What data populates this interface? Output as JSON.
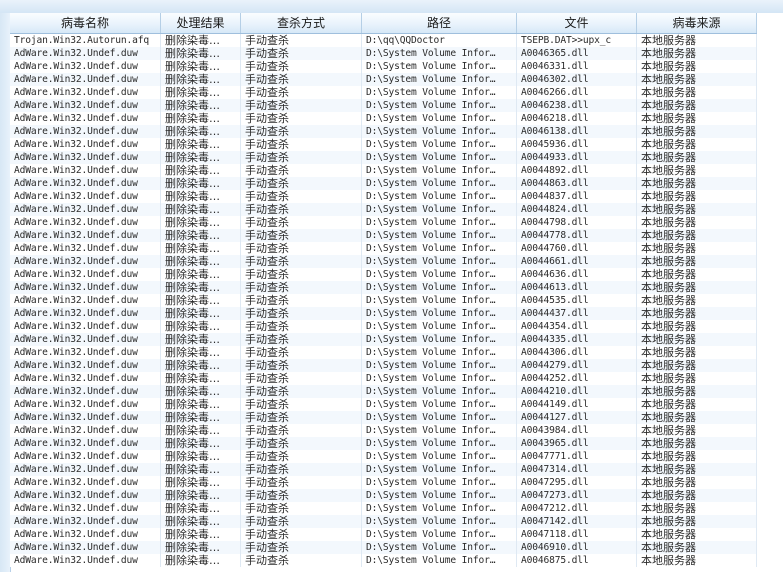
{
  "columns": [
    "病毒名称",
    "处理结果",
    "查杀方式",
    "路径",
    "文件",
    "病毒来源"
  ],
  "rows": [
    [
      "Trojan.Win32.Autorun.afq",
      "删除染毒…",
      "手动查杀",
      "D:\\qq\\QQDoctor",
      "TSEPB.DAT>>upx_c",
      "本地服务器"
    ],
    [
      "AdWare.Win32.Undef.duw",
      "删除染毒…",
      "手动查杀",
      "D:\\System Volume Infor…",
      "A0046365.dll",
      "本地服务器"
    ],
    [
      "AdWare.Win32.Undef.duw",
      "删除染毒…",
      "手动查杀",
      "D:\\System Volume Infor…",
      "A0046331.dll",
      "本地服务器"
    ],
    [
      "AdWare.Win32.Undef.duw",
      "删除染毒…",
      "手动查杀",
      "D:\\System Volume Infor…",
      "A0046302.dll",
      "本地服务器"
    ],
    [
      "AdWare.Win32.Undef.duw",
      "删除染毒…",
      "手动查杀",
      "D:\\System Volume Infor…",
      "A0046266.dll",
      "本地服务器"
    ],
    [
      "AdWare.Win32.Undef.duw",
      "删除染毒…",
      "手动查杀",
      "D:\\System Volume Infor…",
      "A0046238.dll",
      "本地服务器"
    ],
    [
      "AdWare.Win32.Undef.duw",
      "删除染毒…",
      "手动查杀",
      "D:\\System Volume Infor…",
      "A0046218.dll",
      "本地服务器"
    ],
    [
      "AdWare.Win32.Undef.duw",
      "删除染毒…",
      "手动查杀",
      "D:\\System Volume Infor…",
      "A0046138.dll",
      "本地服务器"
    ],
    [
      "AdWare.Win32.Undef.duw",
      "删除染毒…",
      "手动查杀",
      "D:\\System Volume Infor…",
      "A0045936.dll",
      "本地服务器"
    ],
    [
      "AdWare.Win32.Undef.duw",
      "删除染毒…",
      "手动查杀",
      "D:\\System Volume Infor…",
      "A0044933.dll",
      "本地服务器"
    ],
    [
      "AdWare.Win32.Undef.duw",
      "删除染毒…",
      "手动查杀",
      "D:\\System Volume Infor…",
      "A0044892.dll",
      "本地服务器"
    ],
    [
      "AdWare.Win32.Undef.duw",
      "删除染毒…",
      "手动查杀",
      "D:\\System Volume Infor…",
      "A0044863.dll",
      "本地服务器"
    ],
    [
      "AdWare.Win32.Undef.duw",
      "删除染毒…",
      "手动查杀",
      "D:\\System Volume Infor…",
      "A0044837.dll",
      "本地服务器"
    ],
    [
      "AdWare.Win32.Undef.duw",
      "删除染毒…",
      "手动查杀",
      "D:\\System Volume Infor…",
      "A0044824.dll",
      "本地服务器"
    ],
    [
      "AdWare.Win32.Undef.duw",
      "删除染毒…",
      "手动查杀",
      "D:\\System Volume Infor…",
      "A0044798.dll",
      "本地服务器"
    ],
    [
      "AdWare.Win32.Undef.duw",
      "删除染毒…",
      "手动查杀",
      "D:\\System Volume Infor…",
      "A0044778.dll",
      "本地服务器"
    ],
    [
      "AdWare.Win32.Undef.duw",
      "删除染毒…",
      "手动查杀",
      "D:\\System Volume Infor…",
      "A0044760.dll",
      "本地服务器"
    ],
    [
      "AdWare.Win32.Undef.duw",
      "删除染毒…",
      "手动查杀",
      "D:\\System Volume Infor…",
      "A0044661.dll",
      "本地服务器"
    ],
    [
      "AdWare.Win32.Undef.duw",
      "删除染毒…",
      "手动查杀",
      "D:\\System Volume Infor…",
      "A0044636.dll",
      "本地服务器"
    ],
    [
      "AdWare.Win32.Undef.duw",
      "删除染毒…",
      "手动查杀",
      "D:\\System Volume Infor…",
      "A0044613.dll",
      "本地服务器"
    ],
    [
      "AdWare.Win32.Undef.duw",
      "删除染毒…",
      "手动查杀",
      "D:\\System Volume Infor…",
      "A0044535.dll",
      "本地服务器"
    ],
    [
      "AdWare.Win32.Undef.duw",
      "删除染毒…",
      "手动查杀",
      "D:\\System Volume Infor…",
      "A0044437.dll",
      "本地服务器"
    ],
    [
      "AdWare.Win32.Undef.duw",
      "删除染毒…",
      "手动查杀",
      "D:\\System Volume Infor…",
      "A0044354.dll",
      "本地服务器"
    ],
    [
      "AdWare.Win32.Undef.duw",
      "删除染毒…",
      "手动查杀",
      "D:\\System Volume Infor…",
      "A0044335.dll",
      "本地服务器"
    ],
    [
      "AdWare.Win32.Undef.duw",
      "删除染毒…",
      "手动查杀",
      "D:\\System Volume Infor…",
      "A0044306.dll",
      "本地服务器"
    ],
    [
      "AdWare.Win32.Undef.duw",
      "删除染毒…",
      "手动查杀",
      "D:\\System Volume Infor…",
      "A0044279.dll",
      "本地服务器"
    ],
    [
      "AdWare.Win32.Undef.duw",
      "删除染毒…",
      "手动查杀",
      "D:\\System Volume Infor…",
      "A0044252.dll",
      "本地服务器"
    ],
    [
      "AdWare.Win32.Undef.duw",
      "删除染毒…",
      "手动查杀",
      "D:\\System Volume Infor…",
      "A0044210.dll",
      "本地服务器"
    ],
    [
      "AdWare.Win32.Undef.duw",
      "删除染毒…",
      "手动查杀",
      "D:\\System Volume Infor…",
      "A0044149.dll",
      "本地服务器"
    ],
    [
      "AdWare.Win32.Undef.duw",
      "删除染毒…",
      "手动查杀",
      "D:\\System Volume Infor…",
      "A0044127.dll",
      "本地服务器"
    ],
    [
      "AdWare.Win32.Undef.duw",
      "删除染毒…",
      "手动查杀",
      "D:\\System Volume Infor…",
      "A0043984.dll",
      "本地服务器"
    ],
    [
      "AdWare.Win32.Undef.duw",
      "删除染毒…",
      "手动查杀",
      "D:\\System Volume Infor…",
      "A0043965.dll",
      "本地服务器"
    ],
    [
      "AdWare.Win32.Undef.duw",
      "删除染毒…",
      "手动查杀",
      "D:\\System Volume Infor…",
      "A0047771.dll",
      "本地服务器"
    ],
    [
      "AdWare.Win32.Undef.duw",
      "删除染毒…",
      "手动查杀",
      "D:\\System Volume Infor…",
      "A0047314.dll",
      "本地服务器"
    ],
    [
      "AdWare.Win32.Undef.duw",
      "删除染毒…",
      "手动查杀",
      "D:\\System Volume Infor…",
      "A0047295.dll",
      "本地服务器"
    ],
    [
      "AdWare.Win32.Undef.duw",
      "删除染毒…",
      "手动查杀",
      "D:\\System Volume Infor…",
      "A0047273.dll",
      "本地服务器"
    ],
    [
      "AdWare.Win32.Undef.duw",
      "删除染毒…",
      "手动查杀",
      "D:\\System Volume Infor…",
      "A0047212.dll",
      "本地服务器"
    ],
    [
      "AdWare.Win32.Undef.duw",
      "删除染毒…",
      "手动查杀",
      "D:\\System Volume Infor…",
      "A0047142.dll",
      "本地服务器"
    ],
    [
      "AdWare.Win32.Undef.duw",
      "删除染毒…",
      "手动查杀",
      "D:\\System Volume Infor…",
      "A0047118.dll",
      "本地服务器"
    ],
    [
      "AdWare.Win32.Undef.duw",
      "删除染毒…",
      "手动查杀",
      "D:\\System Volume Infor…",
      "A0046910.dll",
      "本地服务器"
    ],
    [
      "AdWare.Win32.Undef.duw",
      "删除染毒…",
      "手动查杀",
      "D:\\System Volume Infor…",
      "A0046875.dll",
      "本地服务器"
    ]
  ]
}
